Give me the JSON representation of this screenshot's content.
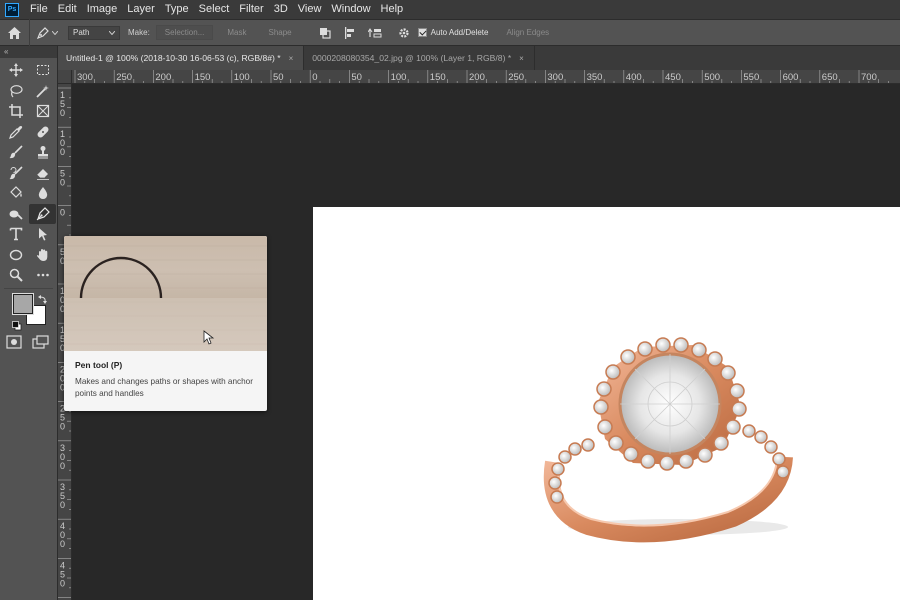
{
  "app": {
    "logo": "Ps"
  },
  "menu": [
    "File",
    "Edit",
    "Image",
    "Layer",
    "Type",
    "Select",
    "Filter",
    "3D",
    "View",
    "Window",
    "Help"
  ],
  "options_bar": {
    "mode_value": "Path",
    "make_label": "Make:",
    "selection_label": "Selection...",
    "mask_label": "Mask",
    "shape_label": "Shape",
    "auto_add_delete_label": "Auto Add/Delete",
    "auto_add_delete_checked": true,
    "align_edges_label": "Align Edges"
  },
  "toolbar": {
    "collapse_glyph": "«"
  },
  "tabs": [
    {
      "title": "Untitled-1 @ 100% (2018-10-30 16-06-53 (c), RGB/8#) *",
      "close": "×",
      "active": true
    },
    {
      "title": "0000208080354_02.jpg @ 100% (Layer 1, RGB/8) *",
      "close": "×",
      "active": false
    }
  ],
  "ruler_h": [
    "300",
    "250",
    "200",
    "150",
    "100",
    "50",
    "0",
    "50",
    "100",
    "150",
    "200",
    "250",
    "300",
    "350",
    "400",
    "450",
    "500",
    "550",
    "600",
    "650",
    "700"
  ],
  "ruler_v": [
    "150",
    "100",
    "50",
    "0",
    "50",
    "100",
    "150",
    "200",
    "250",
    "300",
    "350",
    "400",
    "450",
    "500"
  ],
  "tooltip": {
    "title": "Pen tool (P)",
    "description": "Makes and changes paths or shapes with anchor points and handles"
  },
  "colors": {
    "foreground": "#a7a7a7",
    "background": "#ffffff",
    "accent": "#31a8ff"
  }
}
